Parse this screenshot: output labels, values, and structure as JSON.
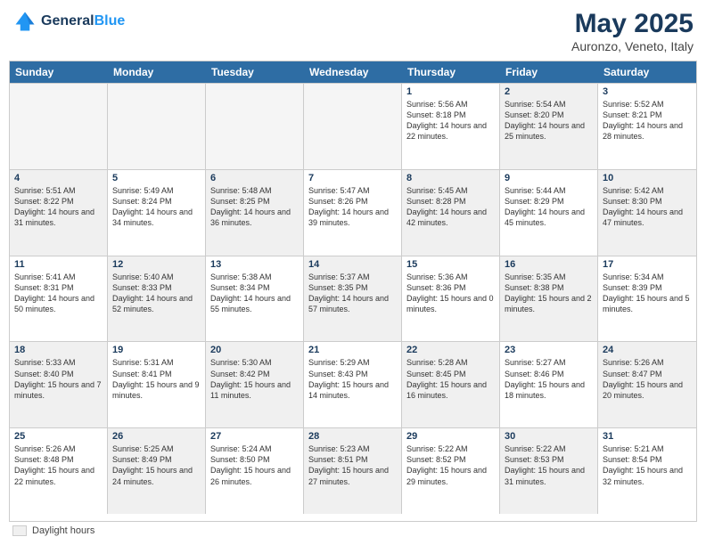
{
  "header": {
    "logo_line1": "General",
    "logo_line2": "Blue",
    "month": "May 2025",
    "location": "Auronzo, Veneto, Italy"
  },
  "legend": {
    "label": "Daylight hours"
  },
  "days_of_week": [
    "Sunday",
    "Monday",
    "Tuesday",
    "Wednesday",
    "Thursday",
    "Friday",
    "Saturday"
  ],
  "weeks": [
    [
      {
        "day": "",
        "info": "",
        "empty": true
      },
      {
        "day": "",
        "info": "",
        "empty": true
      },
      {
        "day": "",
        "info": "",
        "empty": true
      },
      {
        "day": "",
        "info": "",
        "empty": true
      },
      {
        "day": "1",
        "info": "Sunrise: 5:56 AM\nSunset: 8:18 PM\nDaylight: 14 hours\nand 22 minutes."
      },
      {
        "day": "2",
        "info": "Sunrise: 5:54 AM\nSunset: 8:20 PM\nDaylight: 14 hours\nand 25 minutes.",
        "shaded": true
      },
      {
        "day": "3",
        "info": "Sunrise: 5:52 AM\nSunset: 8:21 PM\nDaylight: 14 hours\nand 28 minutes."
      }
    ],
    [
      {
        "day": "4",
        "info": "Sunrise: 5:51 AM\nSunset: 8:22 PM\nDaylight: 14 hours\nand 31 minutes.",
        "shaded": true
      },
      {
        "day": "5",
        "info": "Sunrise: 5:49 AM\nSunset: 8:24 PM\nDaylight: 14 hours\nand 34 minutes."
      },
      {
        "day": "6",
        "info": "Sunrise: 5:48 AM\nSunset: 8:25 PM\nDaylight: 14 hours\nand 36 minutes.",
        "shaded": true
      },
      {
        "day": "7",
        "info": "Sunrise: 5:47 AM\nSunset: 8:26 PM\nDaylight: 14 hours\nand 39 minutes."
      },
      {
        "day": "8",
        "info": "Sunrise: 5:45 AM\nSunset: 8:28 PM\nDaylight: 14 hours\nand 42 minutes.",
        "shaded": true
      },
      {
        "day": "9",
        "info": "Sunrise: 5:44 AM\nSunset: 8:29 PM\nDaylight: 14 hours\nand 45 minutes."
      },
      {
        "day": "10",
        "info": "Sunrise: 5:42 AM\nSunset: 8:30 PM\nDaylight: 14 hours\nand 47 minutes.",
        "shaded": true
      }
    ],
    [
      {
        "day": "11",
        "info": "Sunrise: 5:41 AM\nSunset: 8:31 PM\nDaylight: 14 hours\nand 50 minutes."
      },
      {
        "day": "12",
        "info": "Sunrise: 5:40 AM\nSunset: 8:33 PM\nDaylight: 14 hours\nand 52 minutes.",
        "shaded": true
      },
      {
        "day": "13",
        "info": "Sunrise: 5:38 AM\nSunset: 8:34 PM\nDaylight: 14 hours\nand 55 minutes."
      },
      {
        "day": "14",
        "info": "Sunrise: 5:37 AM\nSunset: 8:35 PM\nDaylight: 14 hours\nand 57 minutes.",
        "shaded": true
      },
      {
        "day": "15",
        "info": "Sunrise: 5:36 AM\nSunset: 8:36 PM\nDaylight: 15 hours\nand 0 minutes."
      },
      {
        "day": "16",
        "info": "Sunrise: 5:35 AM\nSunset: 8:38 PM\nDaylight: 15 hours\nand 2 minutes.",
        "shaded": true
      },
      {
        "day": "17",
        "info": "Sunrise: 5:34 AM\nSunset: 8:39 PM\nDaylight: 15 hours\nand 5 minutes."
      }
    ],
    [
      {
        "day": "18",
        "info": "Sunrise: 5:33 AM\nSunset: 8:40 PM\nDaylight: 15 hours\nand 7 minutes.",
        "shaded": true
      },
      {
        "day": "19",
        "info": "Sunrise: 5:31 AM\nSunset: 8:41 PM\nDaylight: 15 hours\nand 9 minutes."
      },
      {
        "day": "20",
        "info": "Sunrise: 5:30 AM\nSunset: 8:42 PM\nDaylight: 15 hours\nand 11 minutes.",
        "shaded": true
      },
      {
        "day": "21",
        "info": "Sunrise: 5:29 AM\nSunset: 8:43 PM\nDaylight: 15 hours\nand 14 minutes."
      },
      {
        "day": "22",
        "info": "Sunrise: 5:28 AM\nSunset: 8:45 PM\nDaylight: 15 hours\nand 16 minutes.",
        "shaded": true
      },
      {
        "day": "23",
        "info": "Sunrise: 5:27 AM\nSunset: 8:46 PM\nDaylight: 15 hours\nand 18 minutes."
      },
      {
        "day": "24",
        "info": "Sunrise: 5:26 AM\nSunset: 8:47 PM\nDaylight: 15 hours\nand 20 minutes.",
        "shaded": true
      }
    ],
    [
      {
        "day": "25",
        "info": "Sunrise: 5:26 AM\nSunset: 8:48 PM\nDaylight: 15 hours\nand 22 minutes."
      },
      {
        "day": "26",
        "info": "Sunrise: 5:25 AM\nSunset: 8:49 PM\nDaylight: 15 hours\nand 24 minutes.",
        "shaded": true
      },
      {
        "day": "27",
        "info": "Sunrise: 5:24 AM\nSunset: 8:50 PM\nDaylight: 15 hours\nand 26 minutes."
      },
      {
        "day": "28",
        "info": "Sunrise: 5:23 AM\nSunset: 8:51 PM\nDaylight: 15 hours\nand 27 minutes.",
        "shaded": true
      },
      {
        "day": "29",
        "info": "Sunrise: 5:22 AM\nSunset: 8:52 PM\nDaylight: 15 hours\nand 29 minutes."
      },
      {
        "day": "30",
        "info": "Sunrise: 5:22 AM\nSunset: 8:53 PM\nDaylight: 15 hours\nand 31 minutes.",
        "shaded": true
      },
      {
        "day": "31",
        "info": "Sunrise: 5:21 AM\nSunset: 8:54 PM\nDaylight: 15 hours\nand 32 minutes."
      }
    ]
  ]
}
